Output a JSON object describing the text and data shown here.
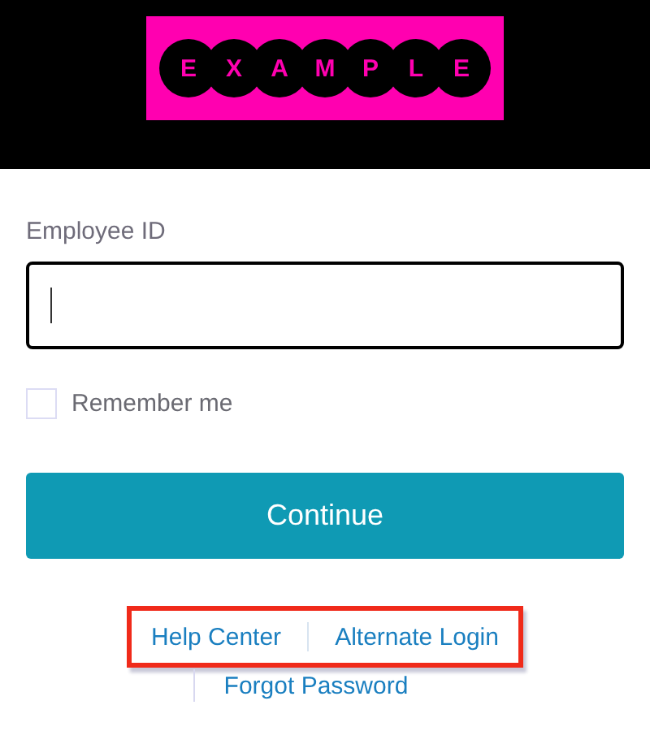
{
  "header": {
    "logo_letters": [
      "E",
      "X",
      "A",
      "M",
      "P",
      "L",
      "E"
    ]
  },
  "employee_id": {
    "label": "Employee ID",
    "focused": true
  },
  "remember_me": {
    "label": "Remember me",
    "checked": false
  },
  "continue_button": "Continue",
  "links": [
    {
      "label": "Help Center",
      "highlighted": true
    },
    {
      "label": "Alternate Login",
      "highlighted": true
    },
    {
      "label": "Forgot Password",
      "highlighted": false
    }
  ]
}
